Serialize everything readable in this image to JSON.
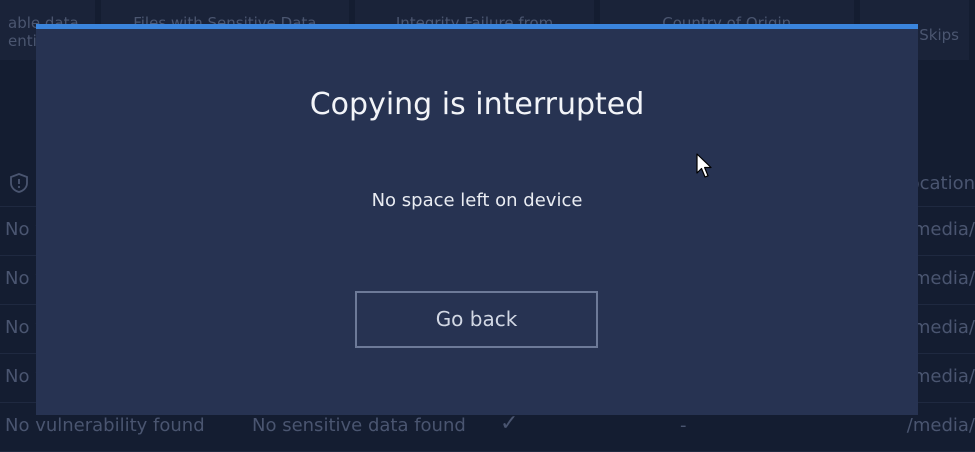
{
  "background": {
    "tabs": [
      {
        "label": "able data\nentic"
      },
      {
        "label": "Files with Sensitive Data"
      },
      {
        "label": "Integrity Failure from"
      },
      {
        "label": "Country of Origin"
      },
      {
        "label": "Skips"
      }
    ],
    "header": {
      "location_label": "ocation"
    },
    "rows": [
      {
        "vulnerability": "No vu",
        "sensitive": "",
        "check": "",
        "dash": "",
        "location": "media/"
      },
      {
        "vulnerability": "No v",
        "sensitive": "",
        "check": "",
        "dash": "",
        "location": "media/"
      },
      {
        "vulnerability": "No v",
        "sensitive": "",
        "check": "",
        "dash": "",
        "location": "media/"
      },
      {
        "vulnerability": "No v",
        "sensitive": "",
        "check": "",
        "dash": "",
        "location": "media/"
      },
      {
        "vulnerability": "No vulnerability found",
        "sensitive": "No sensitive data found",
        "check": "✓",
        "dash": "-",
        "location": "/media/"
      }
    ]
  },
  "dialog": {
    "title": "Copying is interrupted",
    "message": "No space left on device",
    "button_label": "Go back"
  },
  "colors": {
    "accent": "#3a84dc",
    "modal_bg": "#273352",
    "page_bg": "#141d31"
  }
}
